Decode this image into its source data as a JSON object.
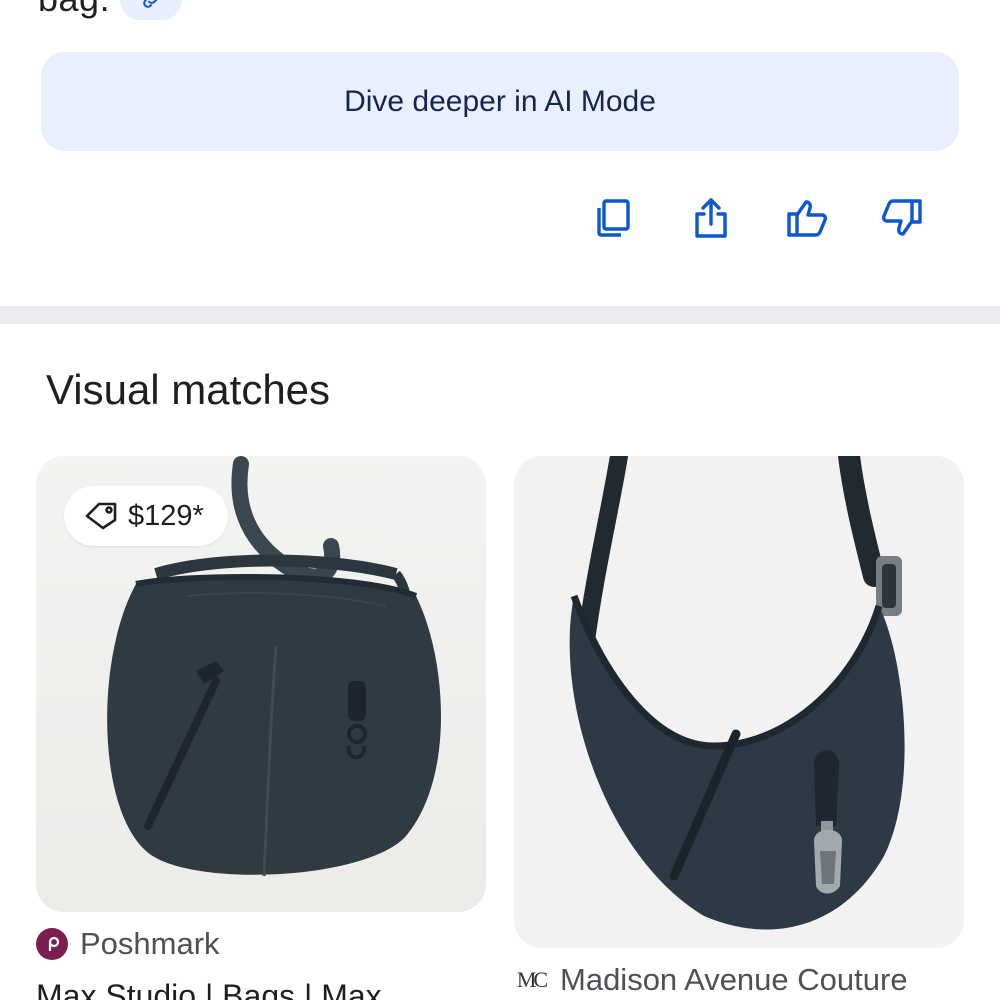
{
  "answer": {
    "trailing_text": "bag.",
    "link_chip_icon": "link-icon"
  },
  "ai_mode": {
    "label": "Dive deeper in AI Mode"
  },
  "actions": [
    {
      "name": "copy-icon"
    },
    {
      "name": "share-icon"
    },
    {
      "name": "thumbs-up-icon"
    },
    {
      "name": "thumbs-down-icon"
    }
  ],
  "visual_matches": {
    "title": "Visual matches",
    "cards": [
      {
        "price": "$129*",
        "price_icon": "price-tag-icon",
        "source": "Poshmark",
        "favicon_text": "P",
        "title": "Max Studio | Bags | Max"
      },
      {
        "source": "Madison Avenue Couture",
        "favicon_text": "MC"
      }
    ]
  },
  "colors": {
    "accent_blue": "#0b57d0",
    "chip_bg": "#e9effd",
    "poshmark_brand": "#7a1f4f",
    "bag_color": "#2f3a43"
  }
}
